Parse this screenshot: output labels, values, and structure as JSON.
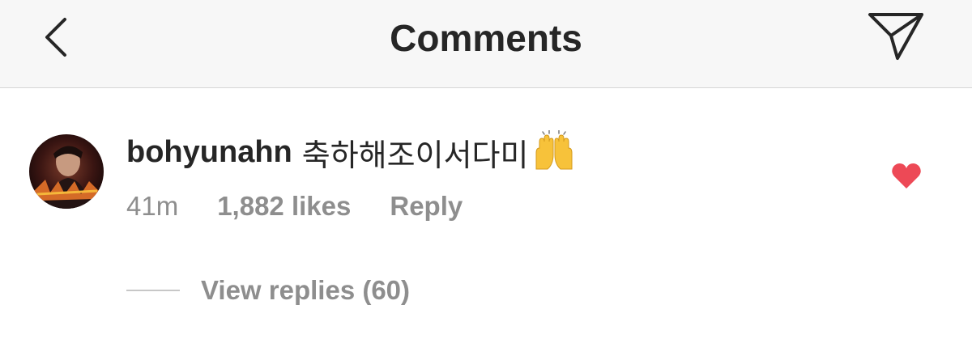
{
  "header": {
    "title": "Comments",
    "back_icon": "chevron-left-icon",
    "send_icon": "paper-plane-icon"
  },
  "comment": {
    "username": "bohyunahn",
    "text": "축하해조이서다미",
    "emoji": "🙌",
    "time": "41m",
    "likes": "1,882 likes",
    "reply_label": "Reply",
    "liked": true,
    "heart_color": "#ed4956",
    "view_replies_label": "View replies (60)"
  }
}
